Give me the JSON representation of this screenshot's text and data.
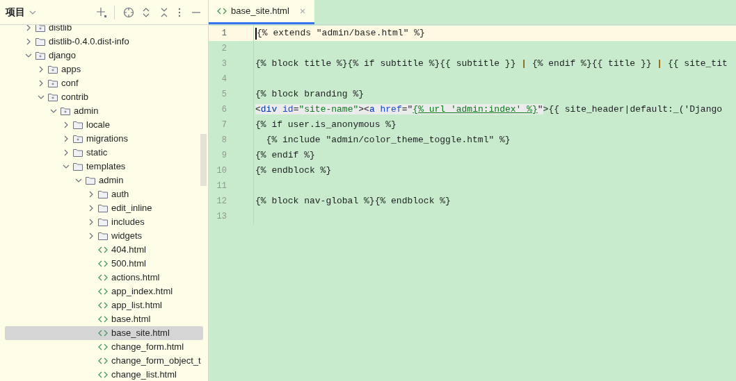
{
  "project_panel": {
    "title": "项目",
    "tree": [
      {
        "label": "distlib",
        "kind": "package",
        "expanded": false
      },
      {
        "label": "distlib-0.4.0.dist-info",
        "kind": "folder",
        "expanded": false
      },
      {
        "label": "django",
        "kind": "package",
        "expanded": true,
        "children": [
          {
            "label": "apps",
            "kind": "package",
            "expanded": false
          },
          {
            "label": "conf",
            "kind": "package",
            "expanded": false
          },
          {
            "label": "contrib",
            "kind": "package",
            "expanded": true,
            "children": [
              {
                "label": "admin",
                "kind": "package",
                "expanded": true,
                "children": [
                  {
                    "label": "locale",
                    "kind": "folder",
                    "expanded": false
                  },
                  {
                    "label": "migrations",
                    "kind": "package",
                    "expanded": false
                  },
                  {
                    "label": "static",
                    "kind": "folder",
                    "expanded": false
                  },
                  {
                    "label": "templates",
                    "kind": "folder",
                    "expanded": true,
                    "children": [
                      {
                        "label": "admin",
                        "kind": "folder",
                        "expanded": true,
                        "children": [
                          {
                            "label": "auth",
                            "kind": "folder",
                            "expanded": false
                          },
                          {
                            "label": "edit_inline",
                            "kind": "folder",
                            "expanded": false
                          },
                          {
                            "label": "includes",
                            "kind": "folder",
                            "expanded": false
                          },
                          {
                            "label": "widgets",
                            "kind": "folder",
                            "expanded": false
                          },
                          {
                            "label": "404.html",
                            "kind": "html",
                            "selected": false
                          },
                          {
                            "label": "500.html",
                            "kind": "html",
                            "selected": false
                          },
                          {
                            "label": "actions.html",
                            "kind": "html",
                            "selected": false
                          },
                          {
                            "label": "app_index.html",
                            "kind": "html",
                            "selected": false
                          },
                          {
                            "label": "app_list.html",
                            "kind": "html",
                            "selected": false
                          },
                          {
                            "label": "base.html",
                            "kind": "html",
                            "selected": false
                          },
                          {
                            "label": "base_site.html",
                            "kind": "html",
                            "selected": true
                          },
                          {
                            "label": "change_form.html",
                            "kind": "html",
                            "selected": false
                          },
                          {
                            "label": "change_form_object_t",
                            "kind": "html",
                            "selected": false
                          },
                          {
                            "label": "change_list.html",
                            "kind": "html",
                            "selected": false
                          }
                        ]
                      }
                    ]
                  }
                ]
              }
            ]
          }
        ]
      }
    ]
  },
  "editor": {
    "tabs": [
      {
        "label": "base_site.html",
        "selected": true
      }
    ],
    "lines": [
      {
        "number": "1",
        "current": true,
        "tokens": [
          {
            "kind": "plain",
            "text": "{% extends \"admin/base.html\" %}"
          }
        ]
      },
      {
        "number": "2",
        "current": false
      },
      {
        "number": "3",
        "current": false,
        "tokens": [
          {
            "kind": "plain",
            "text": "{% block title %}{% if subtitle %}{{ subtitle }} "
          },
          {
            "kind": "pipe",
            "text": "|"
          },
          {
            "kind": "plain",
            "text": " {% endif %}{{ title }} "
          },
          {
            "kind": "pipe",
            "text": "|"
          },
          {
            "kind": "plain",
            "text": " {{ site_tit"
          }
        ]
      },
      {
        "number": "4",
        "current": false
      },
      {
        "number": "5",
        "current": false,
        "tokens": [
          {
            "kind": "plain",
            "text": "{% block branding %}"
          }
        ]
      },
      {
        "number": "6",
        "current": false,
        "tokens": [
          {
            "kind": "hl",
            "text": "<"
          },
          {
            "kind": "tag",
            "text": "div "
          },
          {
            "kind": "attr",
            "text": "id"
          },
          {
            "kind": "hl",
            "text": "="
          },
          {
            "kind": "value",
            "text": "\"site-name\""
          },
          {
            "kind": "hl",
            "text": ">"
          },
          {
            "kind": "hl",
            "text": "<"
          },
          {
            "kind": "tag",
            "text": "a "
          },
          {
            "kind": "attr",
            "text": "href"
          },
          {
            "kind": "hl",
            "text": "=\""
          },
          {
            "kind": "link",
            "text": "{% url 'admin:index' %}"
          },
          {
            "kind": "hl",
            "text": "\""
          },
          {
            "kind": "plain",
            "text": ">{{ site_header|default:_('Django"
          }
        ]
      },
      {
        "number": "7",
        "current": false,
        "tokens": [
          {
            "kind": "plain",
            "text": "{% if user.is_anonymous %}"
          }
        ]
      },
      {
        "number": "8",
        "current": false,
        "tokens": [
          {
            "kind": "plain",
            "text": "  {% include \"admin/color_theme_toggle.html\" %}"
          }
        ]
      },
      {
        "number": "9",
        "current": false,
        "tokens": [
          {
            "kind": "plain",
            "text": "{% endif %}"
          }
        ]
      },
      {
        "number": "10",
        "current": false,
        "tokens": [
          {
            "kind": "plain",
            "text": "{% endblock %}"
          }
        ]
      },
      {
        "number": "11",
        "current": false
      },
      {
        "number": "12",
        "current": false,
        "tokens": [
          {
            "kind": "plain",
            "text": "{% block nav-global %}{% endblock %}"
          }
        ]
      },
      {
        "number": "13",
        "current": false
      }
    ]
  }
}
